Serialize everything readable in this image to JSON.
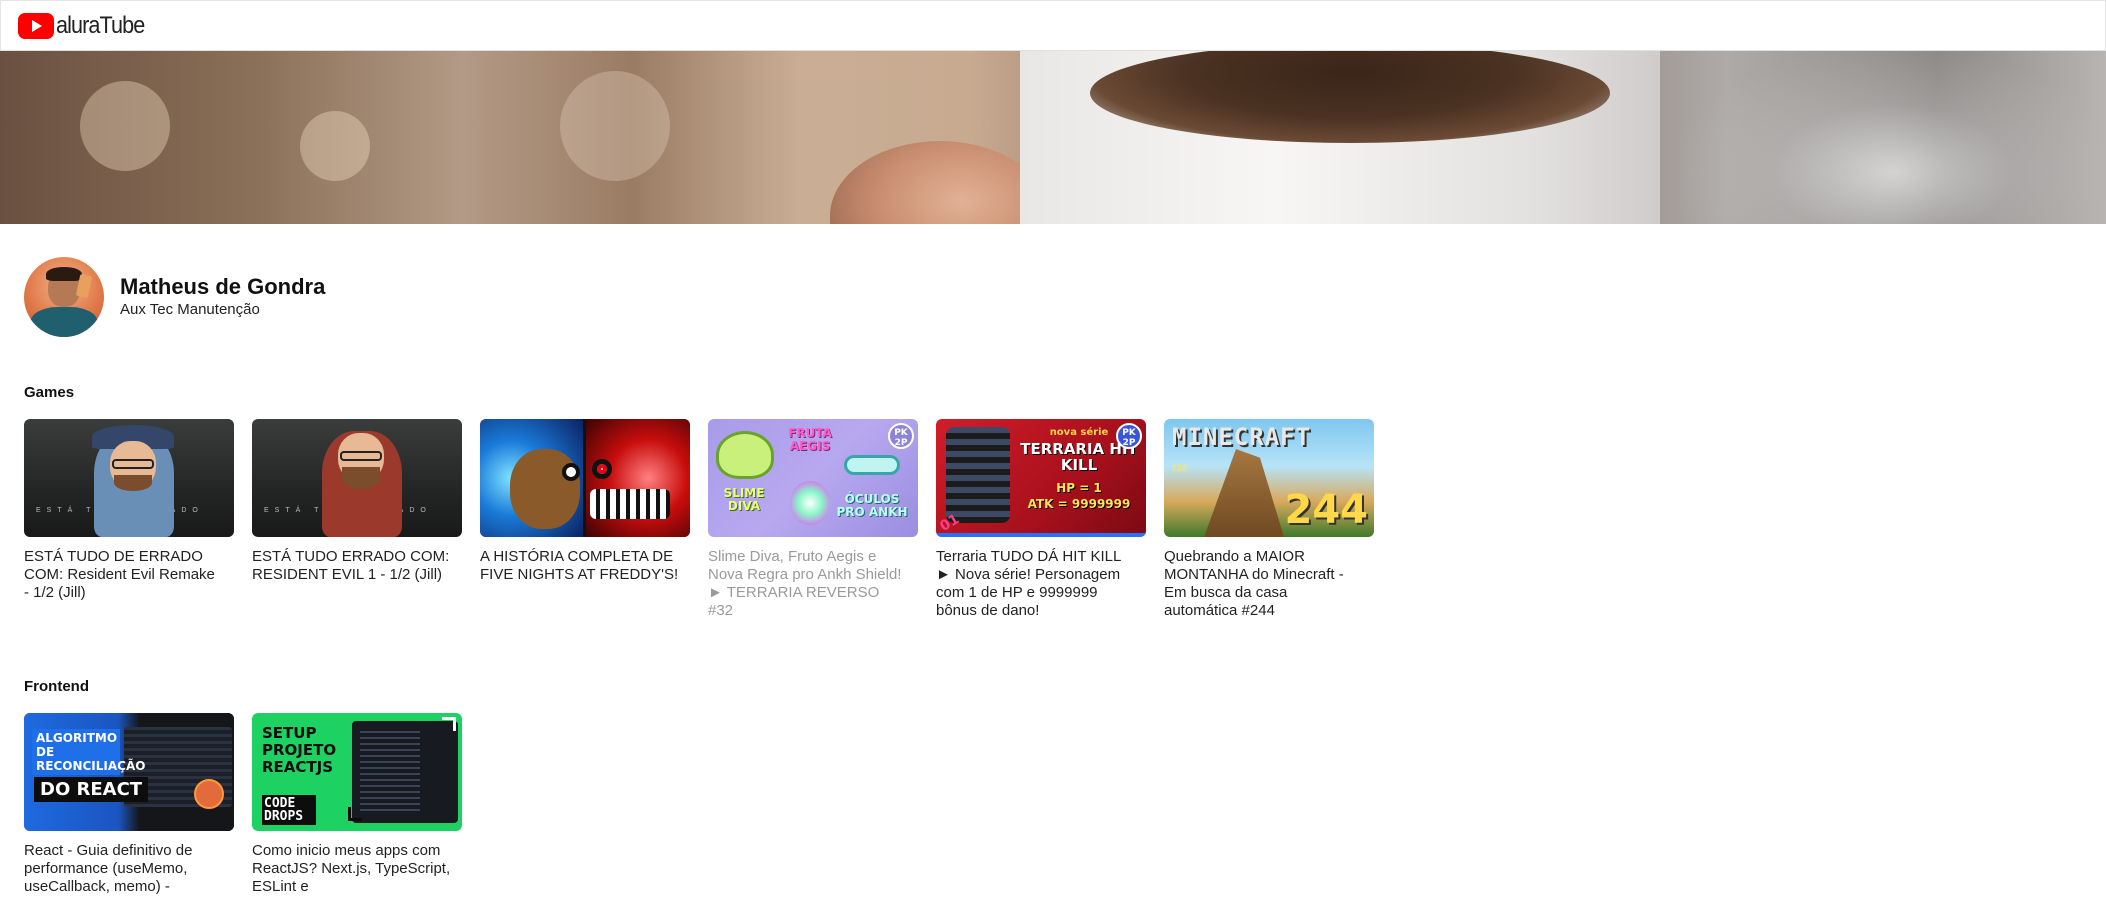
{
  "header": {
    "logo_text": "aluraTube",
    "logo_icon": "youtube-play-icon"
  },
  "banner": {
    "description_icon": "banner-image"
  },
  "profile": {
    "name": "Matheus de Gondra",
    "job": "Aux Tec Manutenção"
  },
  "sections": [
    {
      "title": "Games",
      "videos": [
        {
          "title": "ESTÁ TUDO DE ERRADO COM: Resident Evil Remake - 1/2 (Jill)"
        },
        {
          "title": "ESTÁ TUDO ERRADO COM: RESIDENT EVIL 1 - 1/2 (Jill)"
        },
        {
          "title": "A HISTÓRIA COMPLETA DE FIVE NIGHTS AT FREDDY'S!"
        },
        {
          "title": "Slime Diva, Fruto Aegis e Nova Regra pro Ankh Shield! ► TERRARIA REVERSO #32"
        },
        {
          "title": "Terraria TUDO DÁ HIT KILL ► Nova série! Personagem com 1 de HP e 9999999 bônus de dano!"
        },
        {
          "title": "Quebrando a MAIOR MONTANHA do Minecraft - Em busca da casa automática #244"
        }
      ]
    },
    {
      "title": "Frontend",
      "videos": [
        {
          "title": "React - Guia definitivo de performance (useMemo, useCallback, memo) -"
        },
        {
          "title": "Como inicio meus apps com ReactJS? Next.js, TypeScript, ESLint e"
        }
      ]
    }
  ],
  "thumbnails": {
    "re1_text": "ESTÁ TUDO ERRADO",
    "re2_text": "ESTÁ TUDO ERRADO",
    "slime": {
      "fruta": "FRUTA AEGIS",
      "slime": "SLIME DIVA",
      "oculos": "ÓCULOS PRO ANKH",
      "badge": "PK 2P"
    },
    "terraria": {
      "nova": "nova série",
      "title": "TERRARIA HIT KILL",
      "hp": "HP = 1",
      "atk": "ATK = 9999999",
      "ep": "01",
      "badge": "PK 2P"
    },
    "minecraft": {
      "title": "MINECRAFT",
      "small": "238",
      "number": "244"
    },
    "react": {
      "line1": "ALGORITMO DE RECONCILIAÇÃO",
      "line2": "DO REACT"
    },
    "setup": {
      "title": "SETUP PROJETO REACTJS",
      "code_drops": "CODE DROPS"
    }
  }
}
